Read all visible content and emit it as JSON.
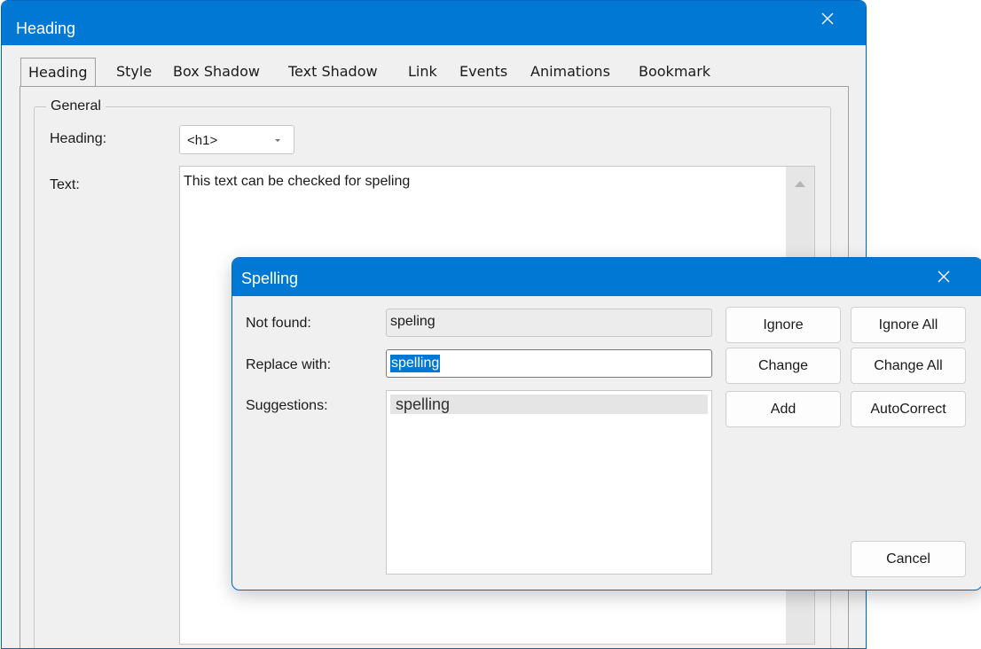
{
  "heading_window": {
    "title": "Heading",
    "tabs": [
      "Heading",
      "Style",
      "Box Shadow",
      "Text Shadow",
      "Link",
      "Events",
      "Animations",
      "Bookmark"
    ],
    "active_tab": "Heading",
    "group_label": "General",
    "heading_label": "Heading:",
    "heading_value": "<h1>",
    "text_label": "Text:",
    "text_value": "This text can be checked for speling"
  },
  "spelling_dialog": {
    "title": "Spelling",
    "not_found_label": "Not found:",
    "not_found_value": "speling",
    "replace_label": "Replace with:",
    "replace_value": "spelling",
    "suggestions_label": "Suggestions:",
    "suggestions": [
      "spelling"
    ],
    "buttons": {
      "ignore": "Ignore",
      "ignore_all": "Ignore All",
      "change": "Change",
      "change_all": "Change All",
      "add": "Add",
      "autocorrect": "AutoCorrect",
      "cancel": "Cancel"
    }
  },
  "colors": {
    "title_bar": "#0078d4",
    "window_bg": "#f0f0f0",
    "selection": "#0078d4"
  },
  "icons": [
    "close-icon",
    "dropdown-arrow-icon",
    "scroll-up-icon"
  ]
}
